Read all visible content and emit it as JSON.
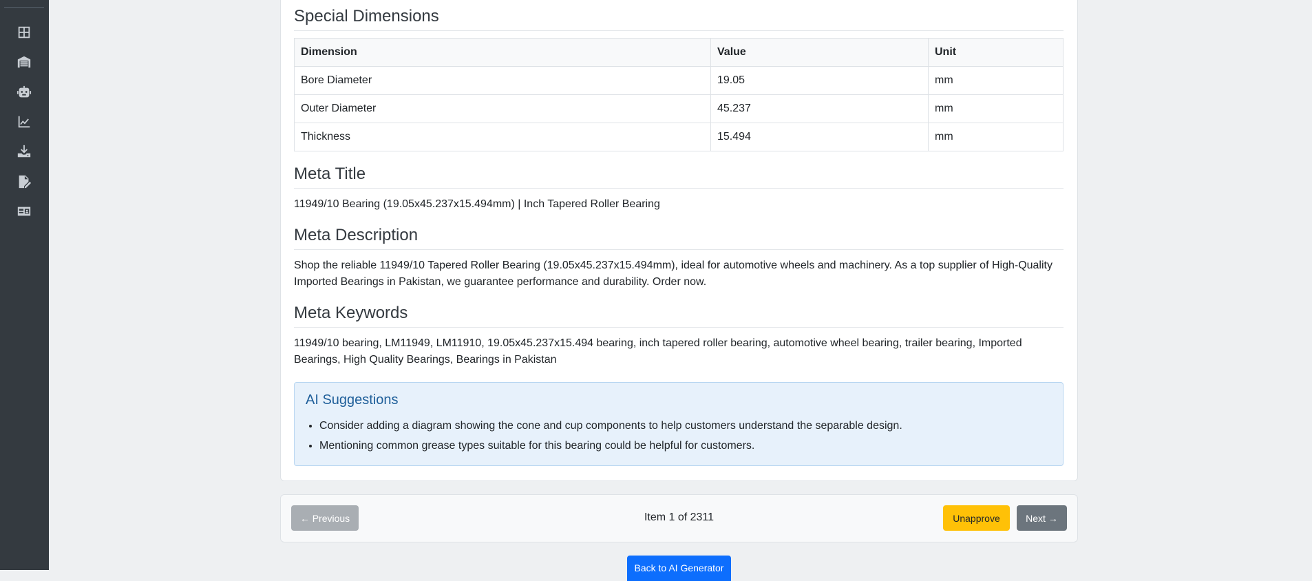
{
  "sidebar": {
    "items": [
      {
        "icon": "dashboard-grid-icon"
      },
      {
        "icon": "warehouse-icon"
      },
      {
        "icon": "robot-icon"
      },
      {
        "icon": "chart-line-icon"
      },
      {
        "icon": "download-icon"
      },
      {
        "icon": "file-edit-icon"
      },
      {
        "icon": "id-card-icon"
      }
    ]
  },
  "special_dimensions": {
    "title": "Special Dimensions",
    "columns": [
      "Dimension",
      "Value",
      "Unit"
    ],
    "rows": [
      [
        "Bore Diameter",
        "19.05",
        "mm"
      ],
      [
        "Outer Diameter",
        "45.237",
        "mm"
      ],
      [
        "Thickness",
        "15.494",
        "mm"
      ]
    ]
  },
  "meta_title": {
    "heading": "Meta Title",
    "text": "11949/10 Bearing (19.05x45.237x15.494mm) | Inch Tapered Roller Bearing"
  },
  "meta_description": {
    "heading": "Meta Description",
    "text": "Shop the reliable 11949/10 Tapered Roller Bearing (19.05x45.237x15.494mm), ideal for automotive wheels and machinery. As a top supplier of High-Quality Imported Bearings in Pakistan, we guarantee performance and durability. Order now."
  },
  "meta_keywords": {
    "heading": "Meta Keywords",
    "text": "11949/10 bearing, LM11949, LM11910, 19.05x45.237x15.494 bearing, inch tapered roller bearing, automotive wheel bearing, trailer bearing, Imported Bearings, High Quality Bearings, Bearings in Pakistan"
  },
  "ai_suggestions": {
    "title": "AI Suggestions",
    "items": [
      "Consider adding a diagram showing the cone and cup components to help customers understand the separable design.",
      "Mentioning common grease types suitable for this bearing could be helpful for customers."
    ]
  },
  "pager": {
    "prev_label": "← Previous",
    "status": "Item 1 of 2311",
    "unapprove_label": "Unapprove",
    "next_label": "Next →"
  },
  "back_label": "Back to AI Generator",
  "colors": {
    "sidebar": "#343a40",
    "info_box": "#e7f1fb",
    "warning_button": "#ffc107",
    "secondary_button": "#6c757d",
    "primary_button": "#0d6efd"
  }
}
